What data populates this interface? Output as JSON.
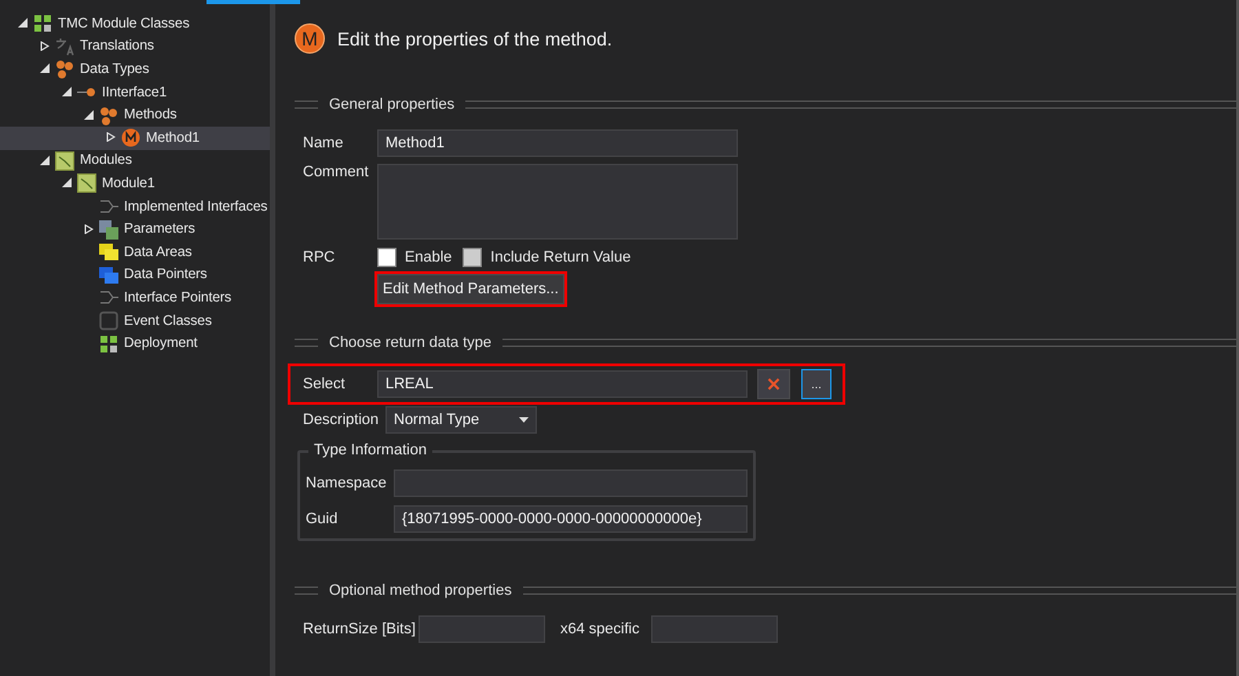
{
  "tree": [
    {
      "label": "TMC Module Classes",
      "kind": "grid",
      "expanded": true,
      "selected": false,
      "children": [
        {
          "label": "Translations",
          "kind": "translate",
          "expanded": false,
          "selected": false
        },
        {
          "label": "Data Types",
          "kind": "cluster",
          "expanded": true,
          "selected": false,
          "children": [
            {
              "label": "IInterface1",
              "kind": "interface",
              "expanded": true,
              "selected": false,
              "children": [
                {
                  "label": "Methods",
                  "kind": "cluster",
                  "expanded": true,
                  "selected": false,
                  "children": [
                    {
                      "label": "Method1",
                      "kind": "method",
                      "expanded": false,
                      "selected": true
                    }
                  ]
                }
              ]
            }
          ]
        },
        {
          "label": "Modules",
          "kind": "module",
          "expanded": true,
          "selected": false,
          "children": [
            {
              "label": "Module1",
              "kind": "module",
              "expanded": true,
              "selected": false,
              "children": [
                {
                  "label": "Implemented Interfaces",
                  "kind": "lines",
                  "selected": false
                },
                {
                  "label": "Parameters",
                  "kind": "params",
                  "expanded": false,
                  "selected": false
                },
                {
                  "label": "Data Areas",
                  "kind": "yellow",
                  "selected": false
                },
                {
                  "label": "Data Pointers",
                  "kind": "blue",
                  "selected": false
                },
                {
                  "label": "Interface Pointers",
                  "kind": "lines",
                  "selected": false
                },
                {
                  "label": "Event Classes",
                  "kind": "event",
                  "selected": false
                },
                {
                  "label": "Deployment",
                  "kind": "grid",
                  "selected": false
                }
              ]
            }
          ]
        }
      ]
    }
  ],
  "header": {
    "icon_letter": "M",
    "text": "Edit the properties of the method."
  },
  "general": {
    "title": "General properties",
    "name_label": "Name",
    "name_value": "Method1",
    "comment_label": "Comment",
    "rpc_label": "RPC",
    "checkboxes": [
      {
        "label": "Enable",
        "checked": false,
        "disabled": false
      },
      {
        "label": "Include Return Value",
        "checked": false,
        "disabled": true
      }
    ],
    "edit_button": {
      "label": "Edit Method Parameters...",
      "highlighted": true
    }
  },
  "return_type": {
    "title": "Choose return data type",
    "select_label": "Select",
    "select_value": "LREAL",
    "browse_label": "...",
    "highlighted": true,
    "description_label": "Description",
    "description_value": "Normal Type",
    "type_info": {
      "title": "Type Information",
      "namespace_label": "Namespace",
      "guid_label": "Guid",
      "guid_value": "{18071995-0000-0000-0000-00000000000e}"
    }
  },
  "optional": {
    "title": "Optional method properties",
    "return_size_label": "ReturnSize [Bits]",
    "x64_label": "x64 specific"
  }
}
